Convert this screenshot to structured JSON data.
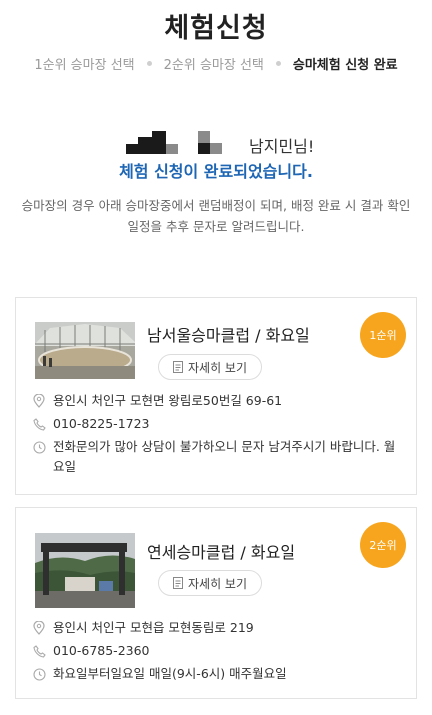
{
  "header": {
    "title": "체험신청",
    "steps": [
      {
        "label": "1순위 승마장 선택",
        "active": false
      },
      {
        "label": "2순위 승마장 선택",
        "active": false
      },
      {
        "label": "승마체험 신청 완료",
        "active": true
      }
    ]
  },
  "result": {
    "name_suffix": "남지민님!",
    "complete_message": "체험 신청이 완료되었습니다.",
    "notice": "승마장의 경우 아래 승마장중에서 랜덤배정이 되며, 배정 완료 시 결과 확인 일정을 추후 문자로 알려드립니다."
  },
  "clubs": [
    {
      "name": "남서울승마클럽 / 화요일",
      "detail_label": "자세히 보기",
      "rank": "1순위",
      "address": "용인시 처인구 모현면 왕림로50번길 69-61",
      "phone": "010-8225-1723",
      "hours": "전화문의가 많아 상담이 불가하오니 문자 남겨주시기 바랍니다. 월요일"
    },
    {
      "name": "연세승마클럽 / 화요일",
      "detail_label": "자세히 보기",
      "rank": "2순위",
      "address": "용인시 처인구 모현읍 모현동림로 219",
      "phone": "010-6785-2360",
      "hours": "화요일부터일요일 매일(9시-6시) 매주월요일"
    }
  ],
  "colors": {
    "accent_blue": "#1e66b4",
    "rank_orange": "#f7a51e",
    "step_inactive": "#9a9a9a"
  }
}
